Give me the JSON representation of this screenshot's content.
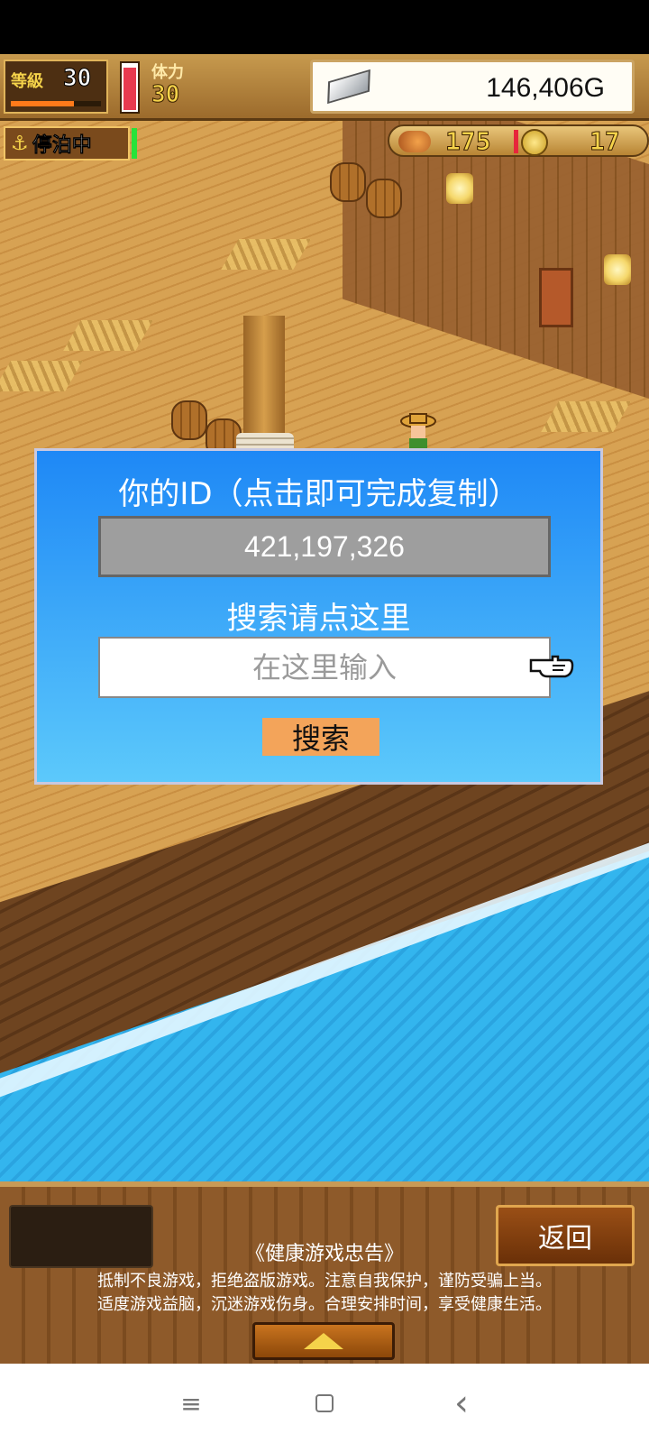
{
  "hud": {
    "level_label": "等級",
    "level_value": "30",
    "stamina_label": "体力",
    "stamina_value": "30",
    "gold": "146,406G",
    "status": "停泊中",
    "food": "175",
    "coins": "17",
    "level_progress": 0.7,
    "stamina_fill": 0.95
  },
  "dialog": {
    "title": "你的ID（点击即可完成复制）",
    "id_value": "421,197,326",
    "search_prompt": "搜索请点这里",
    "search_placeholder": "在这里输入",
    "search_button": "搜索"
  },
  "footer": {
    "back_button": "返回",
    "health_title": "《健康游戏忠告》",
    "health_line1": "抵制不良游戏，拒绝盗版游戏。注意自我保护，谨防受骗上当。",
    "health_line2": "适度游戏益脑，沉迷游戏伤身。合理安排时间，享受健康生活。"
  },
  "nav": {
    "menu_icon": "≡",
    "back_icon": "‹"
  },
  "colors": {
    "dialog_top": "#1e88f6",
    "dialog_bottom": "#5cc9fb",
    "search_button": "#f3a45a"
  }
}
